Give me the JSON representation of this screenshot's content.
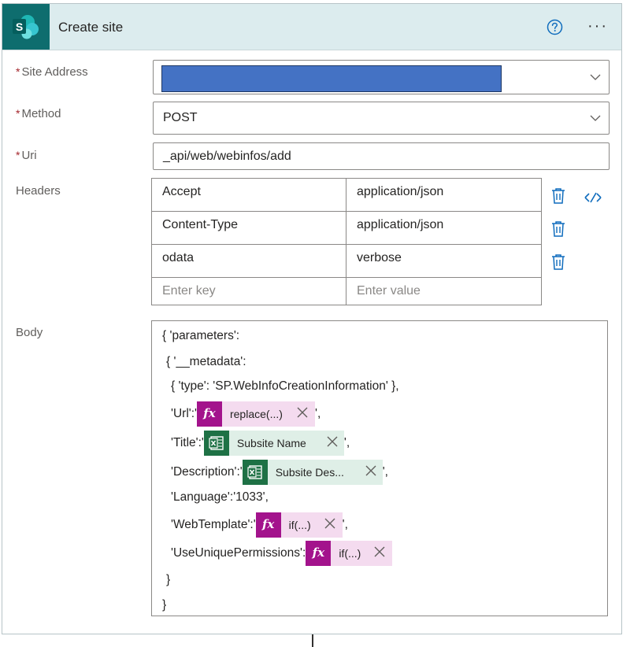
{
  "header": {
    "title": "Create site",
    "app_icon": "sharepoint-icon",
    "help_icon": "help-circle-icon",
    "more_label": "···"
  },
  "form": {
    "required_mark": "*",
    "site_address": {
      "label": "Site Address",
      "value": ""
    },
    "method": {
      "label": "Method",
      "value": "POST"
    },
    "uri": {
      "label": "Uri",
      "value": "_api/web/webinfos/add"
    },
    "headers": {
      "label": "Headers",
      "rows": [
        {
          "key": "Accept",
          "value": "application/json"
        },
        {
          "key": "Content-Type",
          "value": "application/json"
        },
        {
          "key": "odata",
          "value": "verbose"
        }
      ],
      "key_placeholder": "Enter key",
      "value_placeholder": "Enter value"
    },
    "body": {
      "label": "Body",
      "lines": {
        "l1": "{ 'parameters':",
        "l2": "{ '__metadata':",
        "l3": "{ 'type': 'SP.WebInfoCreationInformation' },",
        "l4_pre": "'Url':'",
        "l4_post": "',",
        "l5_pre": "'Title':'",
        "l5_post": "',",
        "l6_pre": "'Description':'",
        "l6_post": "',",
        "l7": "'Language':'1033',",
        "l8_pre": "'WebTemplate':'",
        "l8_post": "',",
        "l9_pre": "'UseUniquePermissions':",
        "l10": "}",
        "l11": "}"
      },
      "tokens": {
        "url": "replace(...)",
        "title": "Subsite Name",
        "description": "Subsite Des...",
        "webtemplate": "if(...)",
        "unique": "if(...)"
      }
    }
  },
  "colors": {
    "header_bg": "#dcecee",
    "app_icon_bg": "#0e6d6e",
    "fx_token": "#a3138c",
    "excel_token": "#1e7145",
    "redaction": "#4472c4",
    "required": "#a4262c"
  }
}
